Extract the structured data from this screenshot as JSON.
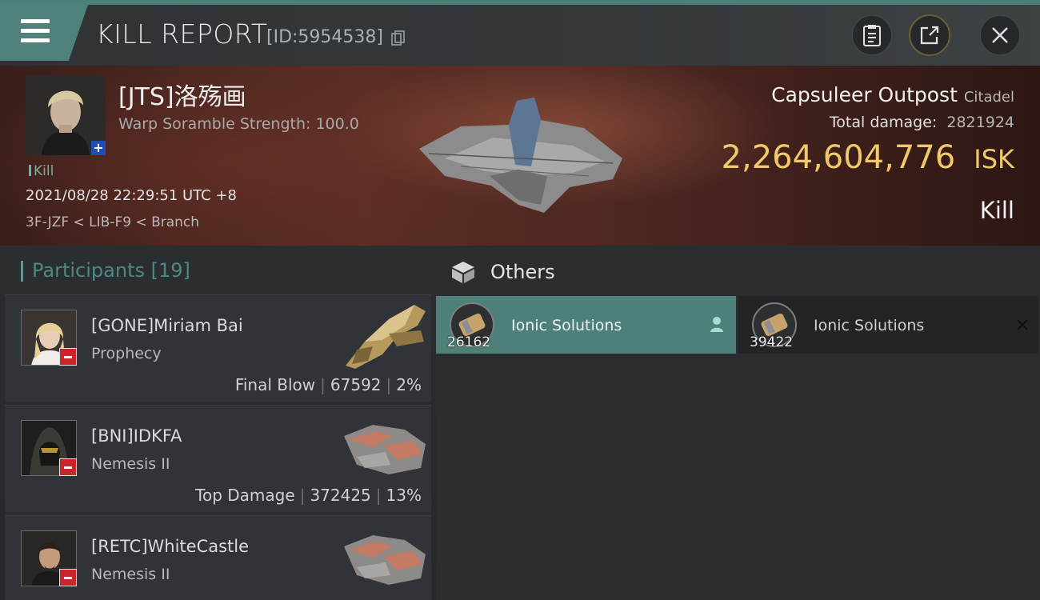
{
  "header": {
    "title": "KILL REPORT",
    "id_text": "[ID:5954538]"
  },
  "victim": {
    "name": "[JTS]洛殇画",
    "warp_scramble": "Warp Soramble Strength: 100.0",
    "kill_tag": "Kill",
    "datetime": "2021/08/28 22:29:51 UTC +8",
    "location": "3F-JZF < LIB-F9 < Branch"
  },
  "target": {
    "name": "Capsuleer Outpost",
    "class": "Citadel",
    "damage_label": "Total damage:",
    "damage_value": "2821924",
    "isk_value": "2,264,604,776",
    "isk_unit": "ISK",
    "result": "Kill"
  },
  "participants": {
    "title": "Participants",
    "count": "[19]",
    "rows": [
      {
        "name": "[GONE]Miriam Bai",
        "ship": "Prophecy",
        "role": "Final Blow",
        "damage": "67592",
        "percent": "2%"
      },
      {
        "name": "[BNI]IDKFA",
        "ship": "Nemesis II",
        "role": "Top Damage",
        "damage": "372425",
        "percent": "13%"
      },
      {
        "name": "[RETC]WhiteCastle",
        "ship": "Nemesis II",
        "role": "",
        "damage": "",
        "percent": ""
      }
    ]
  },
  "others": {
    "title": "Others",
    "items": [
      {
        "name": "Ionic Solutions",
        "qty": "26162",
        "state": "selected"
      },
      {
        "name": "Ionic Solutions",
        "qty": "39422",
        "state": "plain"
      }
    ]
  },
  "colors": {
    "accent": "#4e827b",
    "isk_gold": "#f1c968",
    "badge_red": "#c8262a",
    "badge_blue": "#1f4db8"
  },
  "icons": {
    "menu": "hamburger-menu-icon",
    "copy": "copy-icon",
    "clipboard": "clipboard-icon",
    "share": "share-icon",
    "close": "close-icon",
    "cube": "cube-icon",
    "person": "person-icon",
    "remove": "x-icon"
  }
}
